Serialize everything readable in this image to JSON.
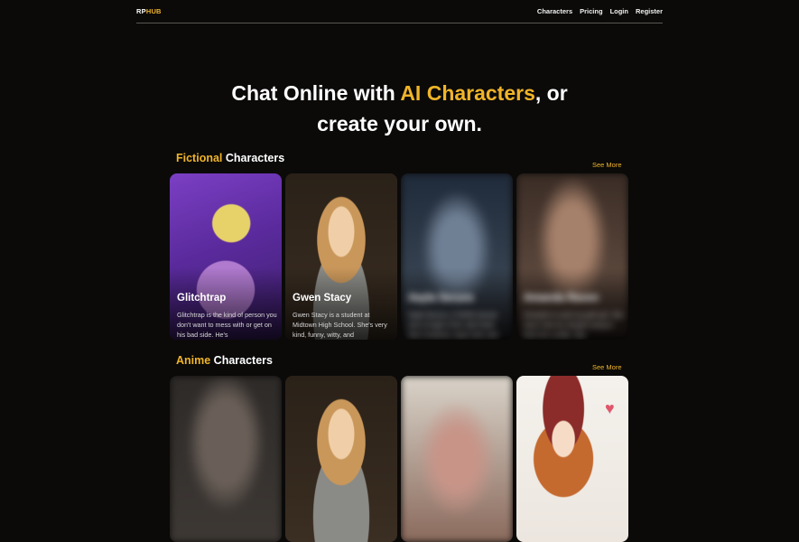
{
  "nav": {
    "logo_rp": "RP",
    "logo_hub": "HUB",
    "links": [
      "Characters",
      "Pricing",
      "Login",
      "Register"
    ]
  },
  "hero": {
    "line1_pre": "Chat Online with ",
    "line1_accent": "AI Characters",
    "line1_post": ", or",
    "line2": "create your own."
  },
  "sections": [
    {
      "accent": "Fictional",
      "title": " Characters",
      "see_more": "See More",
      "cards": [
        {
          "name": "Glitchtrap",
          "desc": "Glitchtrap is the kind of person you don't want to mess with or get on his bad side. He's"
        },
        {
          "name": "Gwen Stacy",
          "desc": "Gwen Stacy is a student at Midtown High School. She's very kind, funny, witty, and"
        },
        {
          "name": "Aayla Secura",
          "desc": "Aayla Secura, a Twi'lek woman and a Knight of the Jedi Order. She is fearless, loyal, kind, and"
        },
        {
          "name": "Amanda Raven",
          "desc": "Amanda is a pent up goth girl. She hasn't had sex despite trying to find it for a while. She"
        }
      ]
    },
    {
      "accent": "Anime",
      "title": " Characters",
      "see_more": "See More"
    }
  ]
}
